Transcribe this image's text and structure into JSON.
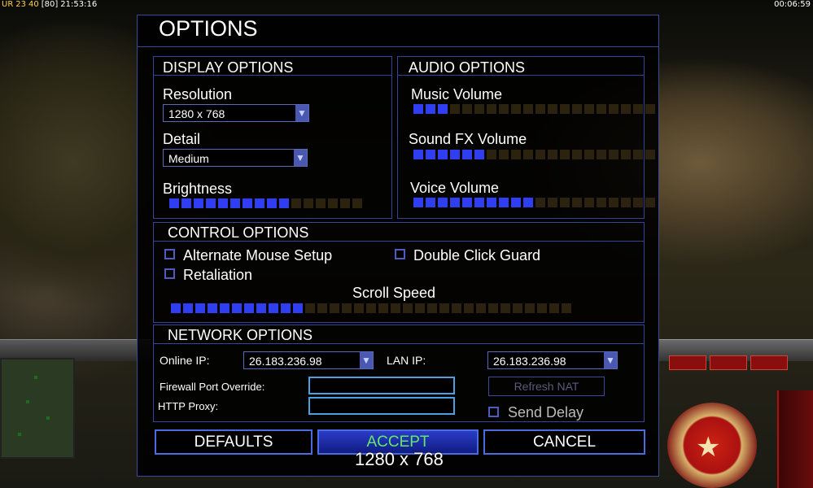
{
  "hud": {
    "top_left": [
      "UR",
      "23",
      "40",
      "[80]",
      "21:53:16"
    ],
    "top_right": "00:06:59"
  },
  "dialog": {
    "title": "OPTIONS"
  },
  "display": {
    "title": "DISPLAY OPTIONS",
    "resolution_label": "Resolution",
    "resolution_value": "1280 x 768",
    "detail_label": "Detail",
    "detail_value": "Medium",
    "brightness_label": "Brightness",
    "brightness_level": 0.625
  },
  "audio": {
    "title": "AUDIO OPTIONS",
    "music_label": "Music Volume",
    "music_level": 0.15,
    "sfx_label": "Sound FX Volume",
    "sfx_level": 0.3,
    "voice_label": "Voice Volume",
    "voice_level": 0.5
  },
  "control": {
    "title": "CONTROL OPTIONS",
    "alt_mouse_label": "Alternate Mouse Setup",
    "double_click_label": "Double Click Guard",
    "retaliation_label": "Retaliation",
    "scroll_label": "Scroll Speed",
    "scroll_level": 0.33
  },
  "network": {
    "title": "NETWORK OPTIONS",
    "online_ip_label": "Online IP:",
    "online_ip_value": "26.183.236.98",
    "lan_ip_label": "LAN IP:",
    "lan_ip_value": "26.183.236.98",
    "firewall_label": "Firewall Port Override:",
    "http_proxy_label": "HTTP Proxy:",
    "refresh_nat_label": "Refresh NAT",
    "send_delay_label": "Send Delay"
  },
  "buttons": {
    "defaults": "DEFAULTS",
    "accept": "ACCEPT",
    "cancel": "CANCEL"
  },
  "toast": "1280 x 768",
  "colors": {
    "accent": "#2f3ef0",
    "border": "#34449a",
    "accept_text": "#64e86a"
  }
}
